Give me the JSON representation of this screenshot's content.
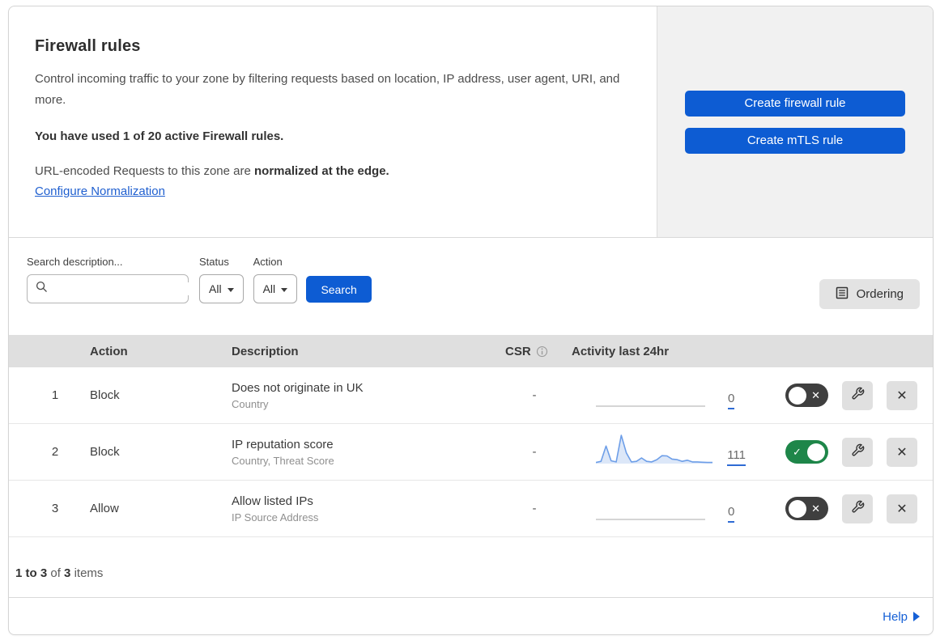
{
  "header": {
    "title": "Firewall rules",
    "description": "Control incoming traffic to your zone by filtering requests based on location, IP address, user agent, URI, and more.",
    "usage": "You have used 1 of 20 active Firewall rules.",
    "normalization_prefix": "URL-encoded Requests to this zone are ",
    "normalization_bold": "normalized at the edge.",
    "normalization_link": "Configure Normalization",
    "create_firewall_button": "Create firewall rule",
    "create_mtls_button": "Create mTLS rule"
  },
  "filters": {
    "search_label": "Search description...",
    "search_value": "",
    "status_label": "Status",
    "status_value": "All",
    "action_label": "Action",
    "action_value": "All",
    "search_button": "Search",
    "ordering_button": "Ordering"
  },
  "table": {
    "columns": {
      "action": "Action",
      "description": "Description",
      "csr": "CSR",
      "activity": "Activity last 24hr"
    },
    "rows": [
      {
        "index": "1",
        "action": "Block",
        "title": "Does not originate in UK",
        "subtitle": "Country",
        "csr": "-",
        "activity_count": "0",
        "enabled": false,
        "sparkline": [
          0,
          0,
          0,
          0,
          0,
          0,
          0,
          0,
          0,
          0,
          0,
          0,
          0,
          0,
          0,
          0,
          0,
          0,
          0,
          0,
          0,
          0,
          0,
          0
        ]
      },
      {
        "index": "2",
        "action": "Block",
        "title": "IP reputation score",
        "subtitle": "Country, Threat Score",
        "csr": "-",
        "activity_count": "111",
        "enabled": true,
        "sparkline": [
          4,
          8,
          62,
          10,
          6,
          100,
          38,
          6,
          8,
          20,
          8,
          6,
          14,
          28,
          27,
          16,
          14,
          8,
          12,
          6,
          6,
          5,
          4,
          4
        ]
      },
      {
        "index": "3",
        "action": "Allow",
        "title": "Allow listed IPs",
        "subtitle": "IP Source Address",
        "csr": "-",
        "activity_count": "0",
        "enabled": false,
        "sparkline": [
          0,
          0,
          0,
          0,
          0,
          0,
          0,
          0,
          0,
          0,
          0,
          0,
          0,
          0,
          0,
          0,
          0,
          0,
          0,
          0,
          0,
          0,
          0,
          0
        ]
      }
    ]
  },
  "footer": {
    "range": "1 to 3",
    "of_text": "of",
    "total": "3",
    "items_text": "items",
    "help_label": "Help"
  },
  "colors": {
    "accent_blue": "#0d5cd3",
    "link_blue": "#2060d0",
    "toggle_on_green": "#1e8649",
    "toggle_off_gray": "#3f3f3f",
    "spark_line": "#6d9ee8",
    "spark_fill": "#dce7f8",
    "spark_flat": "#c7c7c7",
    "header_gray": "#dfdfdf",
    "panel_gray": "#f1f1f1"
  }
}
